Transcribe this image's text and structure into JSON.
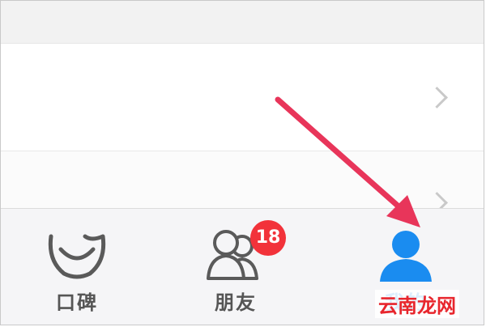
{
  "tab_bar": {
    "tabs": [
      {
        "label": "口碑",
        "icon": "koubei-face-icon",
        "active": false
      },
      {
        "label": "朋友",
        "icon": "friends-icon",
        "active": false,
        "badge": "18"
      },
      {
        "label": "我的",
        "icon": "person-icon",
        "active": true
      }
    ]
  },
  "watermark": "云南龙网",
  "colors": {
    "accent": "#1a8cf0",
    "badge": "#f2323a",
    "arrow": "#e8355a",
    "inactive_icon": "#5a5a5a"
  }
}
